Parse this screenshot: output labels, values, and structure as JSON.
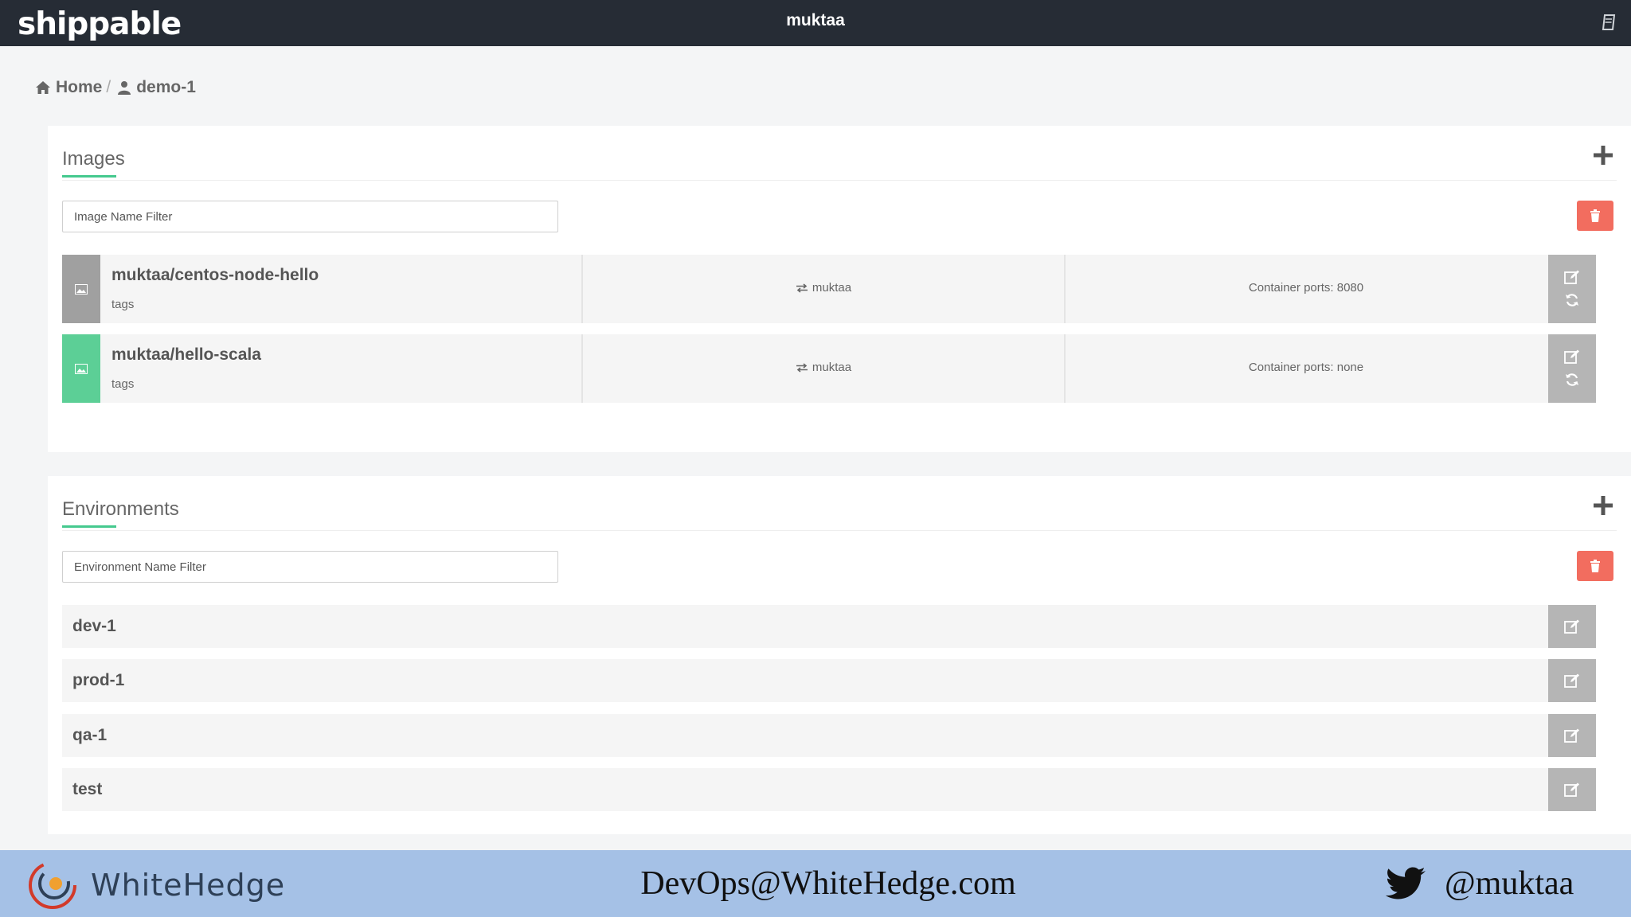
{
  "app": {
    "logo_text": "shippable",
    "current_user": "muktaa"
  },
  "breadcrumb": {
    "home_label": "Home",
    "separator": "/",
    "current_label": "demo-1"
  },
  "images": {
    "title": "Images",
    "filter_placeholder": "Image Name Filter",
    "rows": [
      {
        "name": "muktaa/centos-node-hello",
        "tags_label": "tags",
        "owner": "muktaa",
        "ports": "Container ports: 8080",
        "thumb_color": "#a0a0a0"
      },
      {
        "name": "muktaa/hello-scala",
        "tags_label": "tags",
        "owner": "muktaa",
        "ports": "Container ports: none",
        "thumb_color": "#5ccf96"
      }
    ]
  },
  "environments": {
    "title": "Environments",
    "filter_placeholder": "Environment Name Filter",
    "rows": [
      {
        "name": "dev-1"
      },
      {
        "name": "prod-1"
      },
      {
        "name": "qa-1"
      },
      {
        "name": "test"
      }
    ]
  },
  "footer": {
    "brand_text": "WhiteHedge",
    "email": "DevOps@WhiteHedge.com",
    "twitter_handle": "@muktaa"
  },
  "colors": {
    "topbar": "#262c35",
    "accent_green": "#45c98e",
    "delete_red": "#f26d5f",
    "action_gray": "#b5b5b5",
    "footer_blue": "#a5c1e6"
  }
}
